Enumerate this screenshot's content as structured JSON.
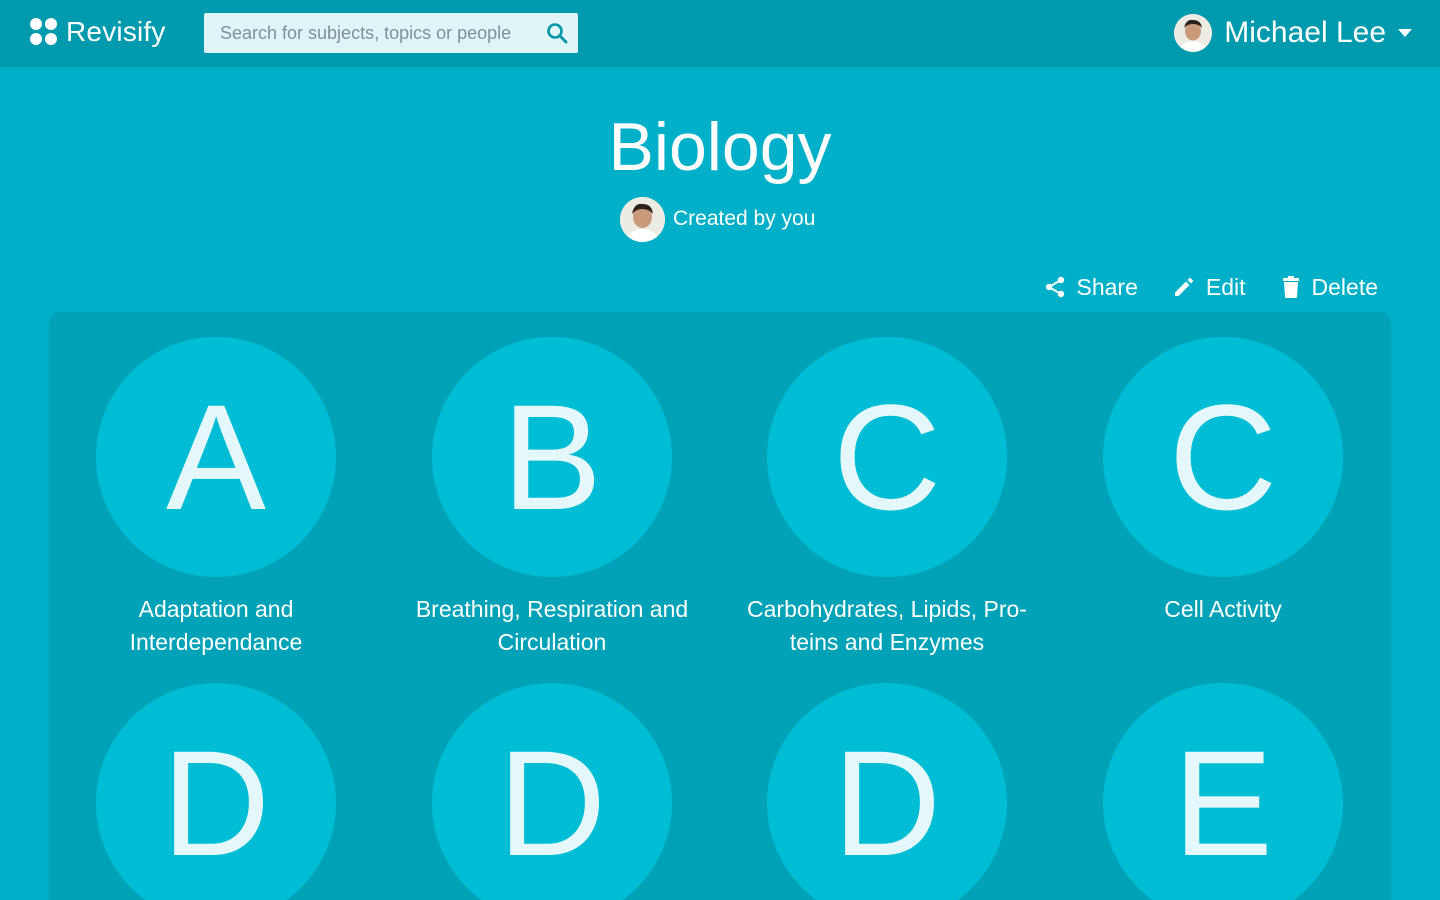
{
  "app": {
    "name": "Revisify"
  },
  "search": {
    "placeholder": "Search for subjects, topics or people"
  },
  "user": {
    "name": "Michael Lee"
  },
  "subject": {
    "title": "Biology",
    "creator_text": "Created by you"
  },
  "actions": {
    "share_label": "Share",
    "edit_label": "Edit",
    "delete_label": "Delete"
  },
  "topics": [
    {
      "letter": "A",
      "label": "Adaptation and Interdependance"
    },
    {
      "letter": "B",
      "label": "Breathing, Respiration and Circulation"
    },
    {
      "letter": "C",
      "label": "Carbohydrates, Lipids, Pro-teins and Enzymes"
    },
    {
      "letter": "C",
      "label": "Cell Activity"
    },
    {
      "letter": "D",
      "label": ""
    },
    {
      "letter": "D",
      "label": ""
    },
    {
      "letter": "D",
      "label": ""
    },
    {
      "letter": "E",
      "label": ""
    }
  ],
  "colors": {
    "background": "#00afc8",
    "topbar": "#009aae",
    "panel": "#00a2b8",
    "circle": "#00bdd6"
  },
  "icons": [
    "logo-dots-icon",
    "search-icon",
    "caret-down-icon",
    "share-icon",
    "pencil-icon",
    "trash-icon"
  ]
}
